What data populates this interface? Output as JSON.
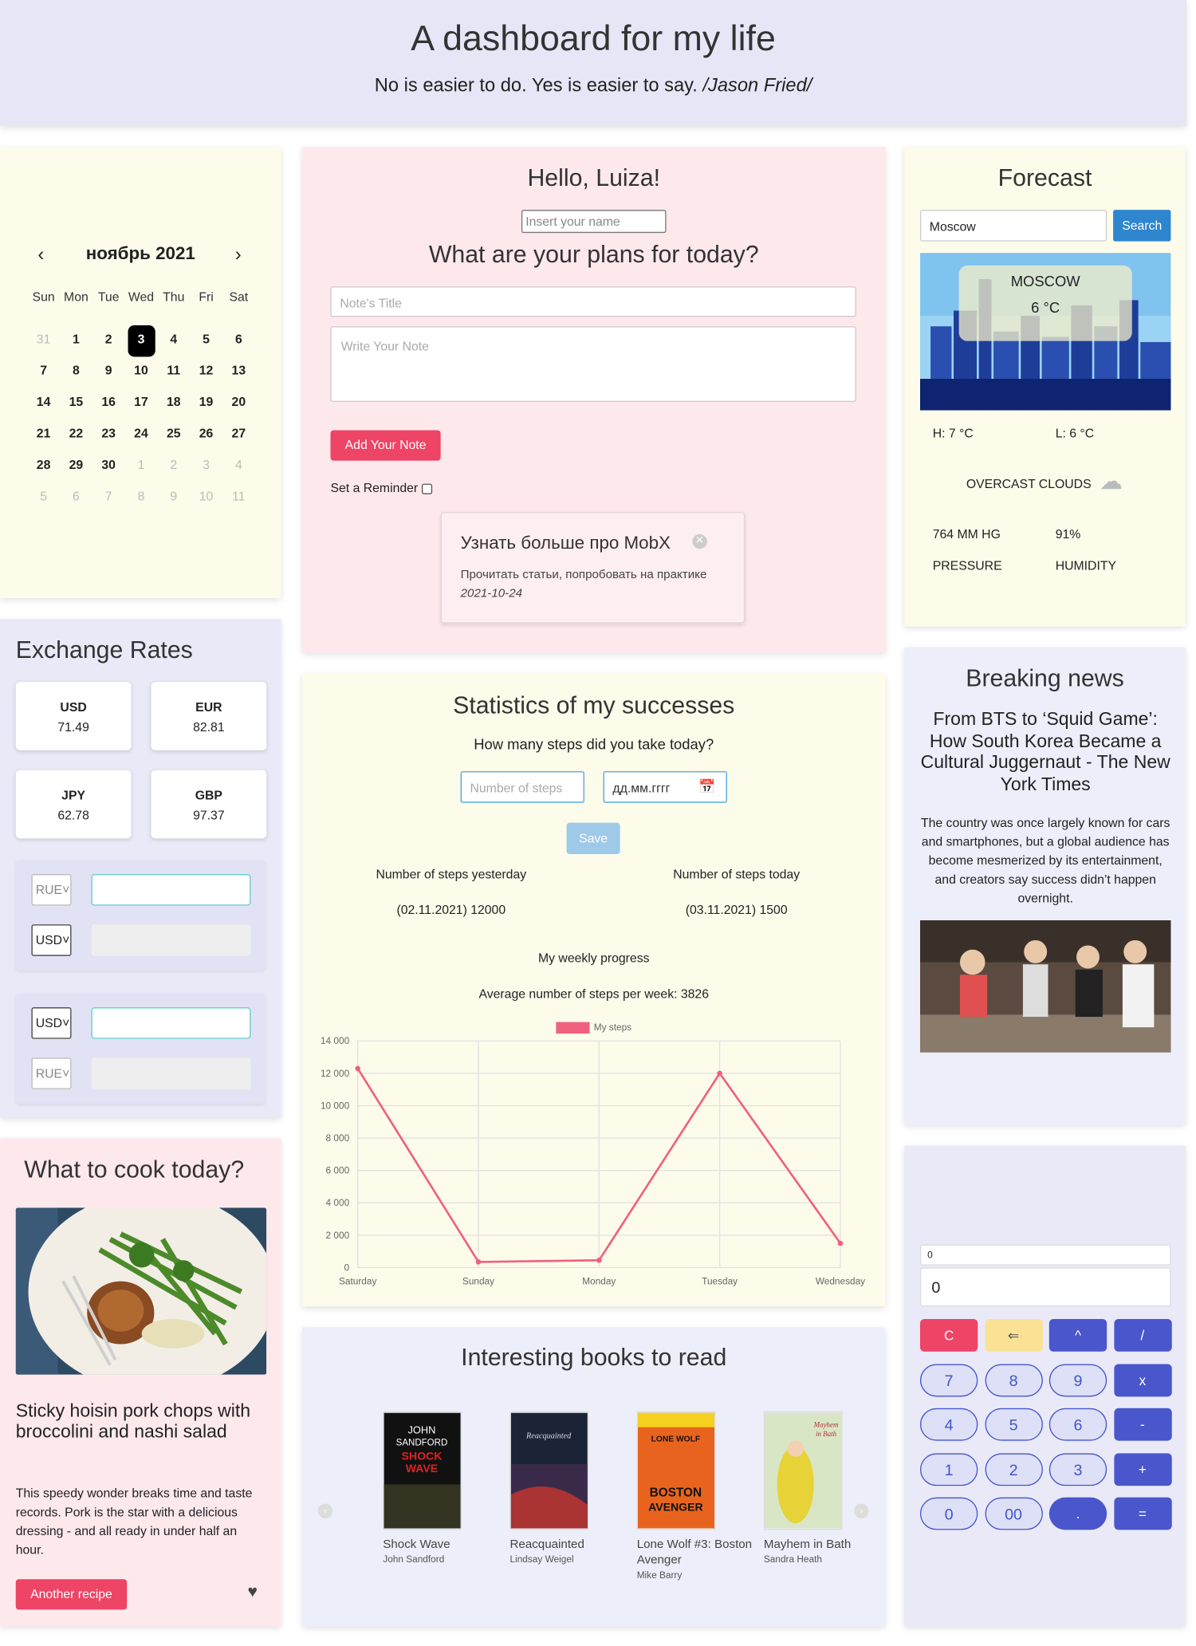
{
  "header": {
    "title": "A dashboard for my life",
    "quote": "No is easier to do. Yes is easier to say.",
    "author": "/Jason Fried/"
  },
  "calendar": {
    "month_label": "ноябрь 2021",
    "weekdays": [
      "Sun",
      "Mon",
      "Tue",
      "Wed",
      "Thu",
      "Fri",
      "Sat"
    ],
    "weeks": [
      [
        "31",
        "1",
        "2",
        "3",
        "4",
        "5",
        "6"
      ],
      [
        "7",
        "8",
        "9",
        "10",
        "11",
        "12",
        "13"
      ],
      [
        "14",
        "15",
        "16",
        "17",
        "18",
        "19",
        "20"
      ],
      [
        "21",
        "22",
        "23",
        "24",
        "25",
        "26",
        "27"
      ],
      [
        "28",
        "29",
        "30",
        "1",
        "2",
        "3",
        "4"
      ],
      [
        "5",
        "6",
        "7",
        "8",
        "9",
        "10",
        "11"
      ]
    ],
    "selected": "3"
  },
  "exchange": {
    "title": "Exchange Rates",
    "rates": [
      {
        "code": "USD",
        "value": "71.49"
      },
      {
        "code": "EUR",
        "value": "82.81"
      },
      {
        "code": "JPY",
        "value": "62.78"
      },
      {
        "code": "GBP",
        "value": "97.37"
      }
    ],
    "converter1": {
      "from": "RUE",
      "to": "USD"
    },
    "converter2": {
      "from": "USD",
      "to": "RUE"
    }
  },
  "cook": {
    "title": "What to cook today?",
    "recipe_title": "Sticky hoisin pork chops with broccolini and nashi salad",
    "description": "This speedy wonder breaks time and taste records. Pork is the star with a delicious dressing - and all ready in under half an hour.",
    "button": "Another recipe"
  },
  "hello": {
    "greeting": "Hello, Luiza!",
    "name_placeholder": "Insert your name",
    "plans_title": "What are your plans for today?",
    "note_title_placeholder": "Note's Title",
    "note_body_placeholder": "Write Your Note",
    "add_button": "Add Your Note",
    "reminder_label": "Set a Reminder",
    "note": {
      "title": "Узнать больше про MobX",
      "body": "Прочитать статьи, попробовать на практике",
      "date": "2021-10-24"
    }
  },
  "stats": {
    "title": "Statistics of my successes",
    "question": "How many steps did you take today?",
    "steps_placeholder": "Number of steps",
    "date_placeholder": "дд.мм.гггг",
    "save_button": "Save",
    "yesterday_label": "Number of steps yesterday",
    "yesterday_value": "(02.11.2021) 12000",
    "today_label": "Number of steps today",
    "today_value": "(03.11.2021) 1500",
    "weekly_label": "My weekly progress",
    "average_label": "Average number of steps per week: 3826"
  },
  "chart_data": {
    "type": "line",
    "categories": [
      "Saturday",
      "Sunday",
      "Monday",
      "Tuesday",
      "Wednesday"
    ],
    "series": [
      {
        "name": "My steps",
        "values": [
          12300,
          350,
          450,
          12000,
          1500
        ],
        "color": "#f0607f"
      }
    ],
    "yticks": [
      "0",
      "2 000",
      "4 000",
      "6 000",
      "8 000",
      "10 000",
      "12 000",
      "14 000"
    ],
    "ylim": [
      0,
      14000
    ],
    "grid": true,
    "legend": "top"
  },
  "books": {
    "title": "Interesting books to read",
    "items": [
      {
        "cover_text": "JOHN SANDFORD SHOCK WAVE",
        "title": "Shock Wave",
        "author": "John Sandford"
      },
      {
        "cover_text": "Reacquainted",
        "title": "Reacquainted",
        "author": "Lindsay Weigel"
      },
      {
        "cover_text": "BOSTON AVENGER",
        "title": "Lone Wolf #3: Boston Avenger",
        "author": "Mike Barry"
      },
      {
        "cover_text": "Mayhem in Bath",
        "title": "Mayhem in Bath",
        "author": "Sandra Heath"
      }
    ]
  },
  "forecast": {
    "title": "Forecast",
    "city_value": "Moscow",
    "search_button": "Search",
    "city": "MOSCOW",
    "temp": "6 °C",
    "high": "H: 7 °C",
    "low": "L: 6 °C",
    "condition": "OVERCAST CLOUDS",
    "pressure_value": "764 MM HG",
    "humidity_value": "91%",
    "pressure_label": "PRESSURE",
    "humidity_label": "HUMIDITY"
  },
  "news": {
    "title": "Breaking news",
    "headline": "From BTS to ‘Squid Game’: How South Korea Became a Cultural Juggernaut - The New York Times",
    "summary": "The country was once largely known for cars and smartphones, but a global audience has become mesmerized by its entertainment, and creators say success didn’t happen overnight."
  },
  "calculator": {
    "expression": "0",
    "display": "0",
    "keys": [
      "C",
      "⇐",
      "^",
      "/",
      "7",
      "8",
      "9",
      "x",
      "4",
      "5",
      "6",
      "-",
      "1",
      "2",
      "3",
      "+",
      "0",
      "00",
      ".",
      "="
    ]
  }
}
